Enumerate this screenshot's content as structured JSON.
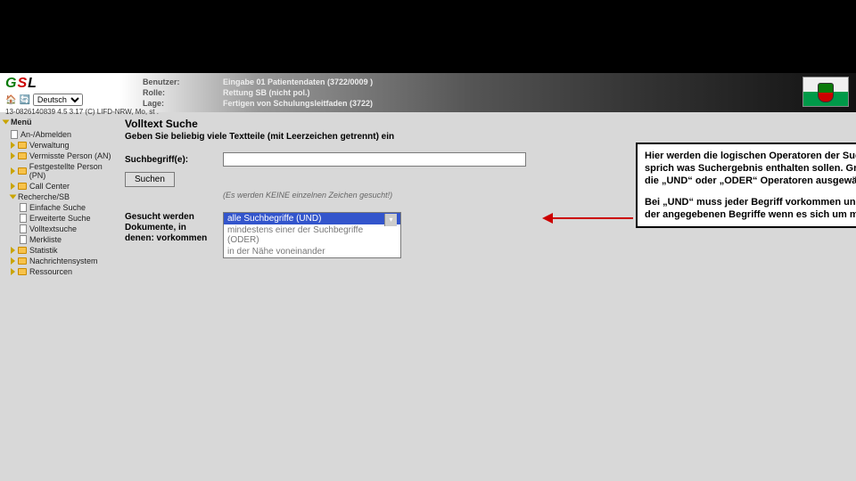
{
  "header": {
    "logo": "GSL",
    "language_selected": "Deutsch",
    "versionline": "13-0826140839 4.5 3.17 (C) LIFD-NRW, Mo, st .",
    "labels": {
      "user": "Benutzer:",
      "role": "Rolle:",
      "situation": "Lage:"
    },
    "values": {
      "user": "Eingabe 01 Patientendaten (3722/0009 )",
      "role": "Rettung SB (nicht pol.)",
      "situation": "Fertigen von Schulungsleitfaden (3722)"
    }
  },
  "sidebar": {
    "menu_label": "Menü",
    "items": [
      {
        "label": "An-/Abmelden",
        "icon": "file"
      },
      {
        "label": "Verwaltung",
        "icon": "folder"
      },
      {
        "label": "Vermisste Person (AN)",
        "icon": "folder"
      },
      {
        "label": "Festgestellte Person (PN)",
        "icon": "folder"
      },
      {
        "label": "Call Center",
        "icon": "folder"
      },
      {
        "label": "Recherche/SB",
        "icon": "folder",
        "expanded": true
      },
      {
        "label": "Einfache Suche",
        "icon": "file",
        "sub": true
      },
      {
        "label": "Erweiterte Suche",
        "icon": "file",
        "sub": true
      },
      {
        "label": "Volltextsuche",
        "icon": "file",
        "sub": true
      },
      {
        "label": "Merkliste",
        "icon": "file",
        "sub": true
      },
      {
        "label": "Statistik",
        "icon": "folder"
      },
      {
        "label": "Nachrichtensystem",
        "icon": "folder"
      },
      {
        "label": "Ressourcen",
        "icon": "folder"
      }
    ]
  },
  "content": {
    "title": "Volltext Suche",
    "subtitle": "Geben Sie beliebig viele Textteile (mit Leerzeichen getrennt) ein",
    "field_label": "Suchbegriff(e):",
    "button": "Suchen",
    "hint": "(Es werden KEINE einzelnen Zeichen gesucht!)",
    "row2_label": "Gesucht werden Dokumente, in denen: vorkommen",
    "select": {
      "selected": "alle Suchbegriffe (UND)",
      "options": [
        "mindestens einer der Suchbegriffe (ODER)",
        "in der Nähe voneinander"
      ]
    }
  },
  "callout": {
    "p1": "Hier werden die logischen Operatoren der Suche ausgewählt, sprich was Suchergebnis enthalten sollen. Grundsätzliche werden die „UND“ oder „ODER“ Operatoren ausgewählt.",
    "p2": "Bei „UND“ muss jeder Begriff vorkommen und bei „ODER“ einer der angegebenen Begriffe wenn es sich um mehrere handelt."
  }
}
